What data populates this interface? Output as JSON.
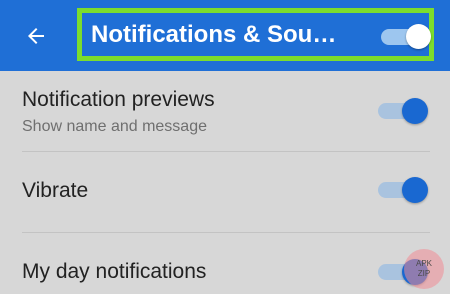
{
  "app_bar": {
    "title": "Notifications & Sou…",
    "back_icon": "arrow-left-icon",
    "master_toggle_on": true,
    "color": "#1f6fd6",
    "highlight_color": "#7cdd2d"
  },
  "settings": [
    {
      "label": "Notification previews",
      "sublabel": "Show name and message",
      "on": true
    },
    {
      "label": "Vibrate",
      "on": true
    },
    {
      "label": "My day notifications",
      "on": true
    }
  ],
  "toggle_colors": {
    "thumb": "#1968d1",
    "track": "#a9c3df"
  },
  "watermark": {
    "line1": "APK",
    "line2": "ZIP"
  }
}
